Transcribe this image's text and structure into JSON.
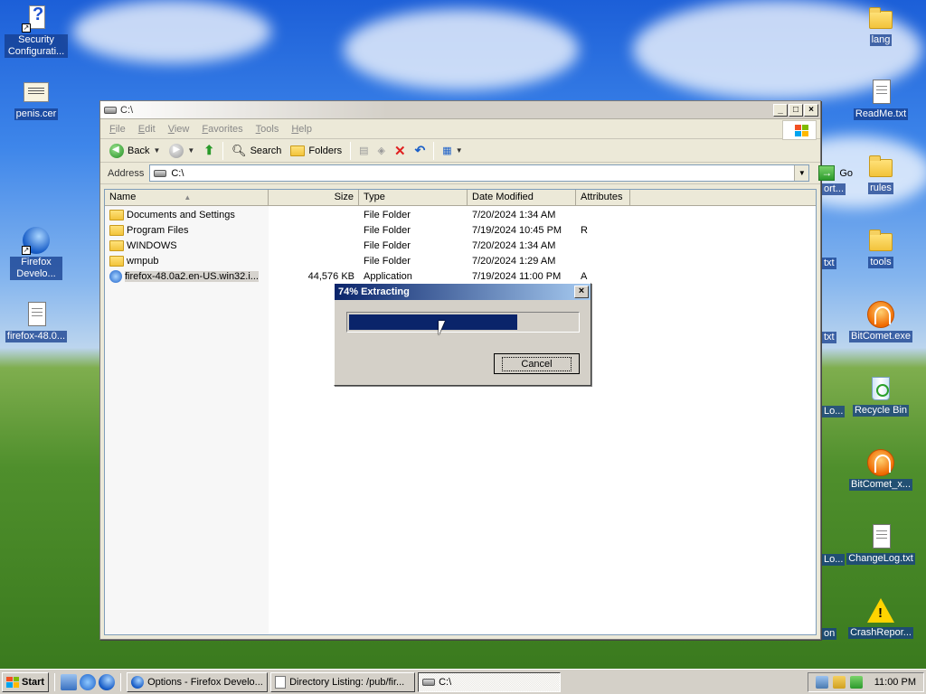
{
  "desktop": {
    "left_icons": [
      {
        "label": "Security Configurati..."
      },
      {
        "label": "penis.cer"
      },
      {
        "label": "Firefox Develo..."
      },
      {
        "label": "firefox-48.0..."
      }
    ],
    "right_icons": [
      {
        "label": "lang"
      },
      {
        "label": "ReadMe.txt"
      },
      {
        "label": "rules"
      },
      {
        "label": "tools"
      },
      {
        "label": "BitComet.exe"
      },
      {
        "label": "Recycle Bin"
      },
      {
        "label": "BitComet_x..."
      },
      {
        "label": "ChangeLog.txt"
      },
      {
        "label": "CrashRepor..."
      }
    ],
    "peek_labels": [
      "ort...",
      "txt",
      "txt",
      "Lo...",
      "Lo...",
      "on"
    ]
  },
  "explorer": {
    "title": "C:\\",
    "menu": [
      "File",
      "Edit",
      "View",
      "Favorites",
      "Tools",
      "Help"
    ],
    "toolbar": {
      "back": "Back",
      "search": "Search",
      "folders": "Folders"
    },
    "address_label": "Address",
    "address_value": "C:\\",
    "go_label": "Go",
    "columns": [
      "Name",
      "Size",
      "Type",
      "Date Modified",
      "Attributes"
    ],
    "rows": [
      {
        "name": "Documents and Settings",
        "size": "",
        "type": "File Folder",
        "date": "7/20/2024 1:34 AM",
        "attr": "",
        "kind": "folder"
      },
      {
        "name": "Program Files",
        "size": "",
        "type": "File Folder",
        "date": "7/19/2024 10:45 PM",
        "attr": "R",
        "kind": "folder"
      },
      {
        "name": "WINDOWS",
        "size": "",
        "type": "File Folder",
        "date": "7/20/2024 1:34 AM",
        "attr": "",
        "kind": "folder"
      },
      {
        "name": "wmpub",
        "size": "",
        "type": "File Folder",
        "date": "7/20/2024 1:29 AM",
        "attr": "",
        "kind": "folder"
      },
      {
        "name": "firefox-48.0a2.en-US.win32.i...",
        "size": "44,576 KB",
        "type": "Application",
        "date": "7/19/2024 11:00 PM",
        "attr": "A",
        "kind": "app"
      }
    ]
  },
  "dialog": {
    "title": "74% Extracting",
    "progress": 0.74,
    "cancel_label": "Cancel",
    "close_glyph": "×"
  },
  "taskbar": {
    "start_label": "Start",
    "tasks": [
      {
        "label": "Options - Firefox Develo..."
      },
      {
        "label": "Directory Listing: /pub/fir..."
      },
      {
        "label": "C:\\"
      }
    ],
    "clock": "11:00 PM"
  },
  "colors": {
    "progress_fill": "#0a246a",
    "dialog_title_start": "#0a246a",
    "selection": "#316ac5"
  }
}
